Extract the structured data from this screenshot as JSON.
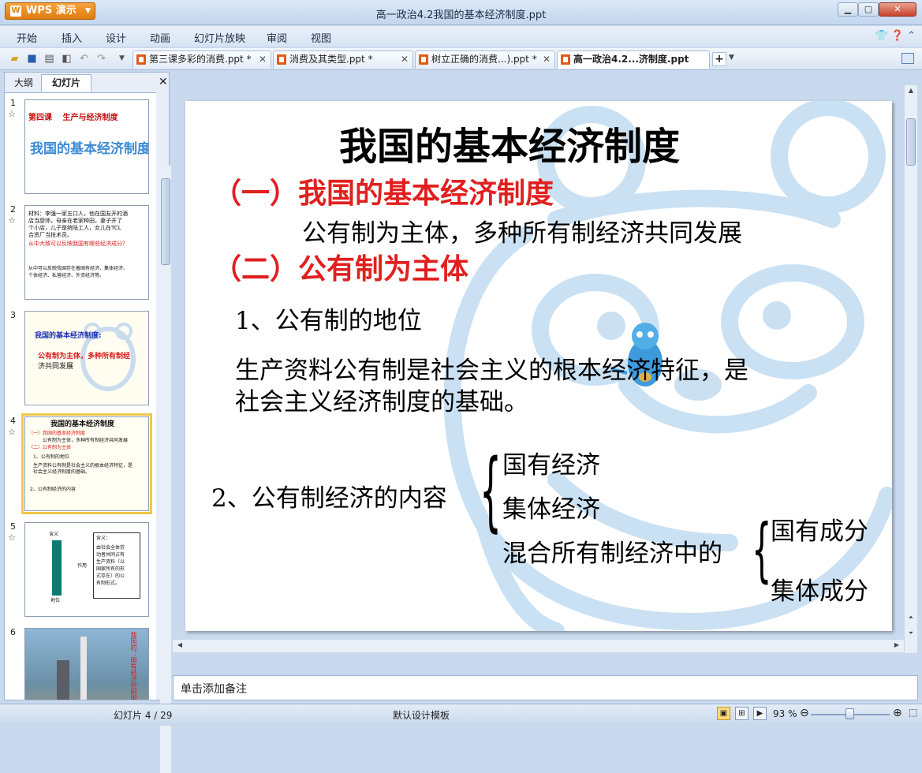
{
  "app": {
    "name": "WPS 演示",
    "window_title": "高一政治4.2我国的基本经济制度.ppt"
  },
  "menu": [
    "开始",
    "插入",
    "设计",
    "动画",
    "幻灯片放映",
    "审阅",
    "视图"
  ],
  "tabs": [
    {
      "label": "第三课多彩的消费.ppt *",
      "active": false
    },
    {
      "label": "消费及其类型.ppt *",
      "active": false
    },
    {
      "label": "树立正确的消费...).ppt *",
      "active": false
    },
    {
      "label": "高一政治4.2...济制度.ppt",
      "active": true
    }
  ],
  "panel": {
    "tab_outline": "大纲",
    "tab_slides": "幻灯片"
  },
  "thumbnails": [
    {
      "num": "1",
      "lines": [
        "第四课　 生产与经济制度",
        "我国的基本经济制度"
      ]
    },
    {
      "num": "2",
      "lines": [
        "材料：李强一家五口人，他在国友开的酒",
        "店当厨师，母亲在老家种田，妻子开了",
        "个小店，儿子是统陆工人，女儿在TCL",
        "合资厂当技术员。",
        "从中大致可以反映我国有哪些经济成分？",
        "从中可以反映我国存在着国有经济、集体经济、",
        "个体经济、私营经济、外资经济等。"
      ]
    },
    {
      "num": "3",
      "lines": [
        "我国的基本经济制度:",
        "公有制为主体，多种所有制经",
        "济共同发展"
      ]
    },
    {
      "num": "4",
      "lines": [
        "我国的基本经济制度",
        "（一）我国的基本经济制度",
        "公有制为主体，多种所有制经济共同发展",
        "（二）公有制为主体",
        "1、公有制的地位",
        "生产资料公有制是社会主义的根本经济特征，是",
        "社会主义经济制度的基础。",
        "2、公有制经济的内容"
      ]
    },
    {
      "num": "5",
      "lines": [
        "含义",
        "含义：",
        "由社会全体劳",
        "动者共同占有",
        "生产资料（以",
        "国家所有的形",
        "式存在）的公",
        "有制形式。",
        "作用",
        "地位"
      ]
    },
    {
      "num": "6",
      "lines": [
        "我国的：国有经济控制国民经济命脉"
      ]
    }
  ],
  "slide": {
    "title": "我国的基本经济制度",
    "h1": "（一）我国的基本经济制度",
    "h1_body": "公有制为主体，多种所有制经济共同发展",
    "h2": "（二）公有制为主体",
    "p1_label": "1、公有制的地位",
    "p1_line1": "生产资料公有制是社会主义的根本经济特征，是",
    "p1_line2": "社会主义经济制度的基础。",
    "p2_label": "2、公有制经济的内容",
    "items": [
      "国有经济",
      "集体经济",
      "混合所有制经济中的"
    ],
    "sub_items": [
      "国有成分",
      "集体成分"
    ]
  },
  "notes_placeholder": "单击添加备注",
  "status": {
    "slide_pos": "幻灯片 4 / 29",
    "template": "默认设计模板",
    "zoom": "93 %"
  },
  "colors": {
    "heading_red": "#e0201f",
    "bear_blue": "#9fc6e6",
    "accent_orange": "#e17c10"
  }
}
